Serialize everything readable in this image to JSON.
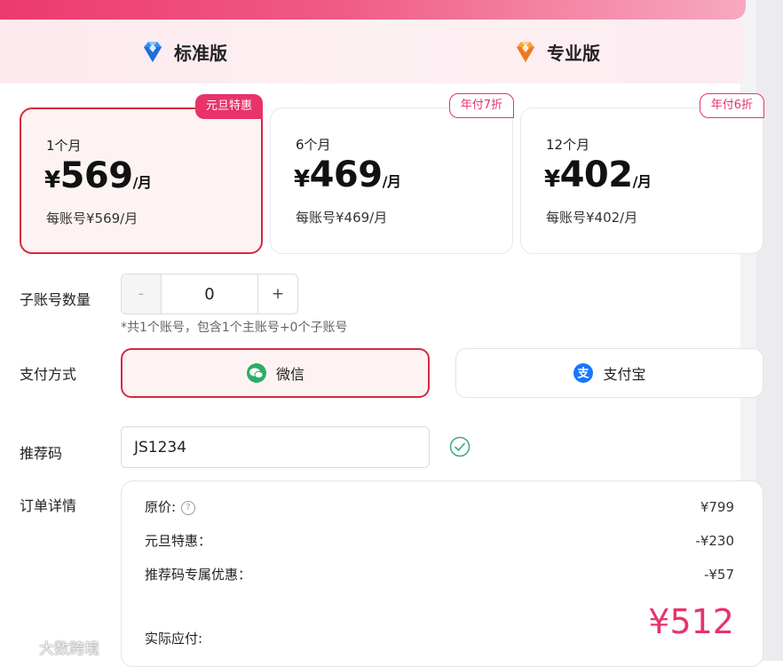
{
  "tabs": {
    "standard": {
      "label": "标准版",
      "icon": "blue-diamond-icon",
      "color": "#3b8ff0"
    },
    "pro": {
      "label": "专业版",
      "icon": "orange-diamond-icon",
      "color": "#f28a2c"
    }
  },
  "plans": [
    {
      "period": "1个月",
      "yen": "¥",
      "price": "569",
      "unit": "/月",
      "per_account": "每账号¥569/月",
      "badge": "元旦特惠",
      "selected": true
    },
    {
      "period": "6个月",
      "yen": "¥",
      "price": "469",
      "unit": "/月",
      "per_account": "每账号¥469/月",
      "badge": "年付7折",
      "selected": false
    },
    {
      "period": "12个月",
      "yen": "¥",
      "price": "402",
      "unit": "/月",
      "per_account": "每账号¥402/月",
      "badge": "年付6折",
      "selected": false
    }
  ],
  "sub_accounts": {
    "label": "子账号数量",
    "minus": "-",
    "value": "0",
    "plus": "+",
    "note": "*共1个账号，包含1个主账号+0个子账号"
  },
  "payment": {
    "label": "支付方式",
    "wechat": "微信",
    "alipay": "支付宝",
    "selected": "wechat"
  },
  "referral": {
    "label": "推荐码",
    "value": "JS1234",
    "valid": true
  },
  "order": {
    "label": "订单详情",
    "original_label": "原价:",
    "original_value": "¥799",
    "promo_label": "元旦特惠：",
    "promo_value": "-¥230",
    "ref_label": "推荐码专属优惠：",
    "ref_value": "-¥57",
    "total_label": "实际应付:",
    "total_value": "¥512"
  },
  "watermark": "大数跨境",
  "colors": {
    "accent": "#e8336a",
    "selected_border": "#d62a3e",
    "wechat_green": "#2aae67",
    "alipay_blue": "#1677ff"
  }
}
